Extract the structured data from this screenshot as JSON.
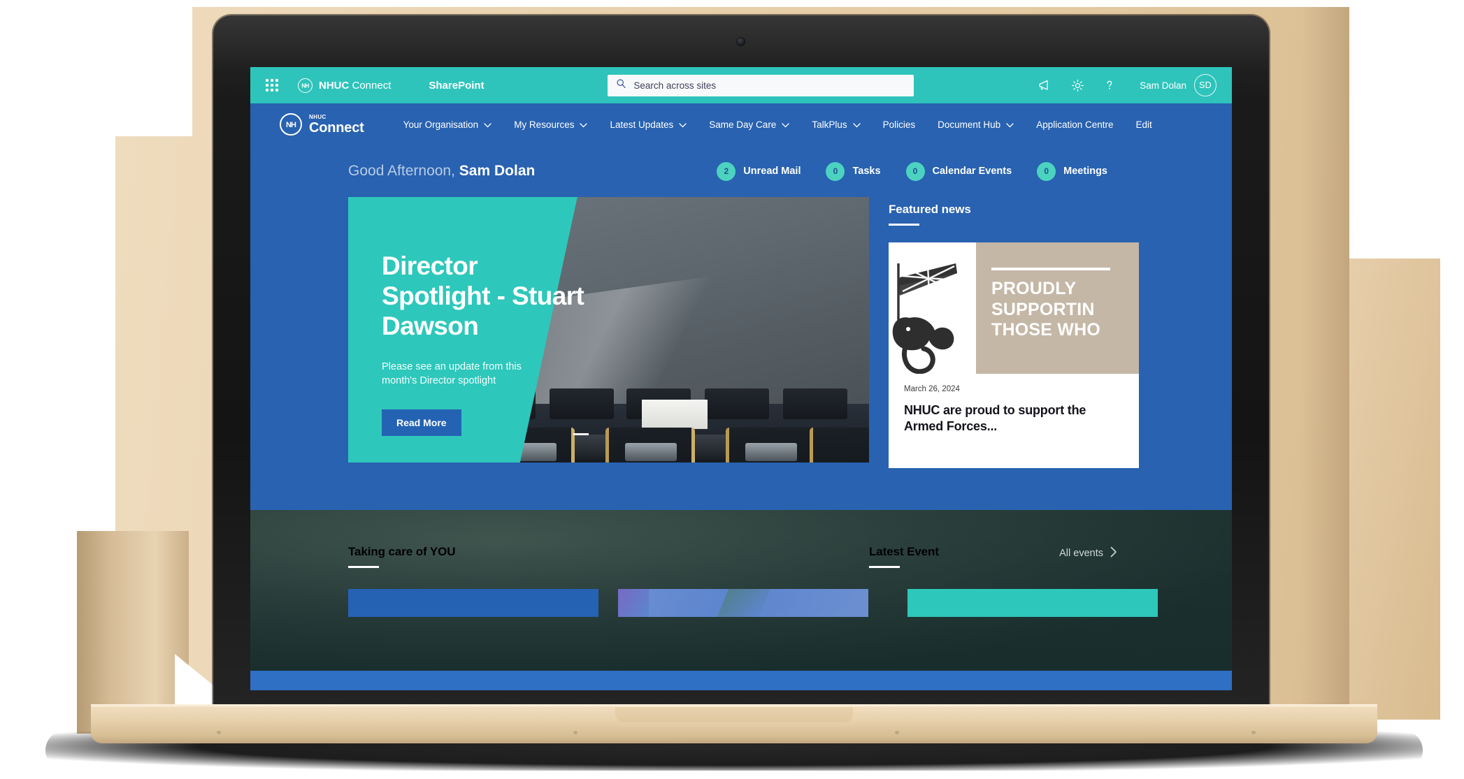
{
  "suite_bar": {
    "app_launcher": "app-launcher",
    "brand_initials": "NH",
    "brand_name_bold": "NHUC",
    "brand_name_rest": " Connect",
    "app_name": "SharePoint",
    "search": {
      "placeholder": "Search across sites",
      "value": ""
    },
    "icons": [
      "megaphone-icon",
      "gear-icon",
      "help-icon"
    ],
    "user": {
      "name": "Sam Dolan",
      "initials": "SD"
    }
  },
  "site_nav": {
    "logo_initials": "NH",
    "logo_small": "NHUC",
    "logo_big": "Connect",
    "items": [
      {
        "label": "Your Organisation",
        "has_chevron": true
      },
      {
        "label": "My Resources",
        "has_chevron": true
      },
      {
        "label": "Latest Updates",
        "has_chevron": true
      },
      {
        "label": "Same Day Care",
        "has_chevron": true
      },
      {
        "label": "TalkPlus",
        "has_chevron": true
      },
      {
        "label": "Policies",
        "has_chevron": false
      },
      {
        "label": "Document Hub",
        "has_chevron": true
      },
      {
        "label": "Application Centre",
        "has_chevron": false
      },
      {
        "label": "Edit",
        "has_chevron": false
      }
    ]
  },
  "greeting": {
    "salutation": "Good Afternoon,",
    "name": "Sam Dolan",
    "stats": [
      {
        "count": "2",
        "label": "Unread Mail"
      },
      {
        "count": "0",
        "label": "Tasks"
      },
      {
        "count": "0",
        "label": "Calendar Events"
      },
      {
        "count": "0",
        "label": "Meetings"
      }
    ]
  },
  "hero": {
    "title": "Director Spotlight - Stuart Dawson",
    "subtitle": "Please see an update from this month's Director spotlight",
    "button_label": "Read More",
    "image_alt": "boardroom-photo"
  },
  "featured_news": {
    "heading": "Featured news",
    "card": {
      "thumb_line1": "PROUDLY",
      "thumb_line2": "SUPPORTIN",
      "thumb_line3": "THOSE WHO",
      "thumb_icon": "lion-union-jack-icon",
      "date": "March 26, 2024",
      "title": "NHUC are proud to support the Armed Forces..."
    }
  },
  "lower": {
    "taking_care_heading": "Taking care of YOU",
    "latest_event_heading": "Latest Event",
    "all_events_label": "All events"
  },
  "colors": {
    "suite_teal": "#2ec4bb",
    "nav_blue": "#2862b0",
    "accent_blue": "#2463b4",
    "hero_teal": "#2ec7bb",
    "bubble_green": "#4cd3c0",
    "laptop_gold": "#e6d0ab"
  }
}
